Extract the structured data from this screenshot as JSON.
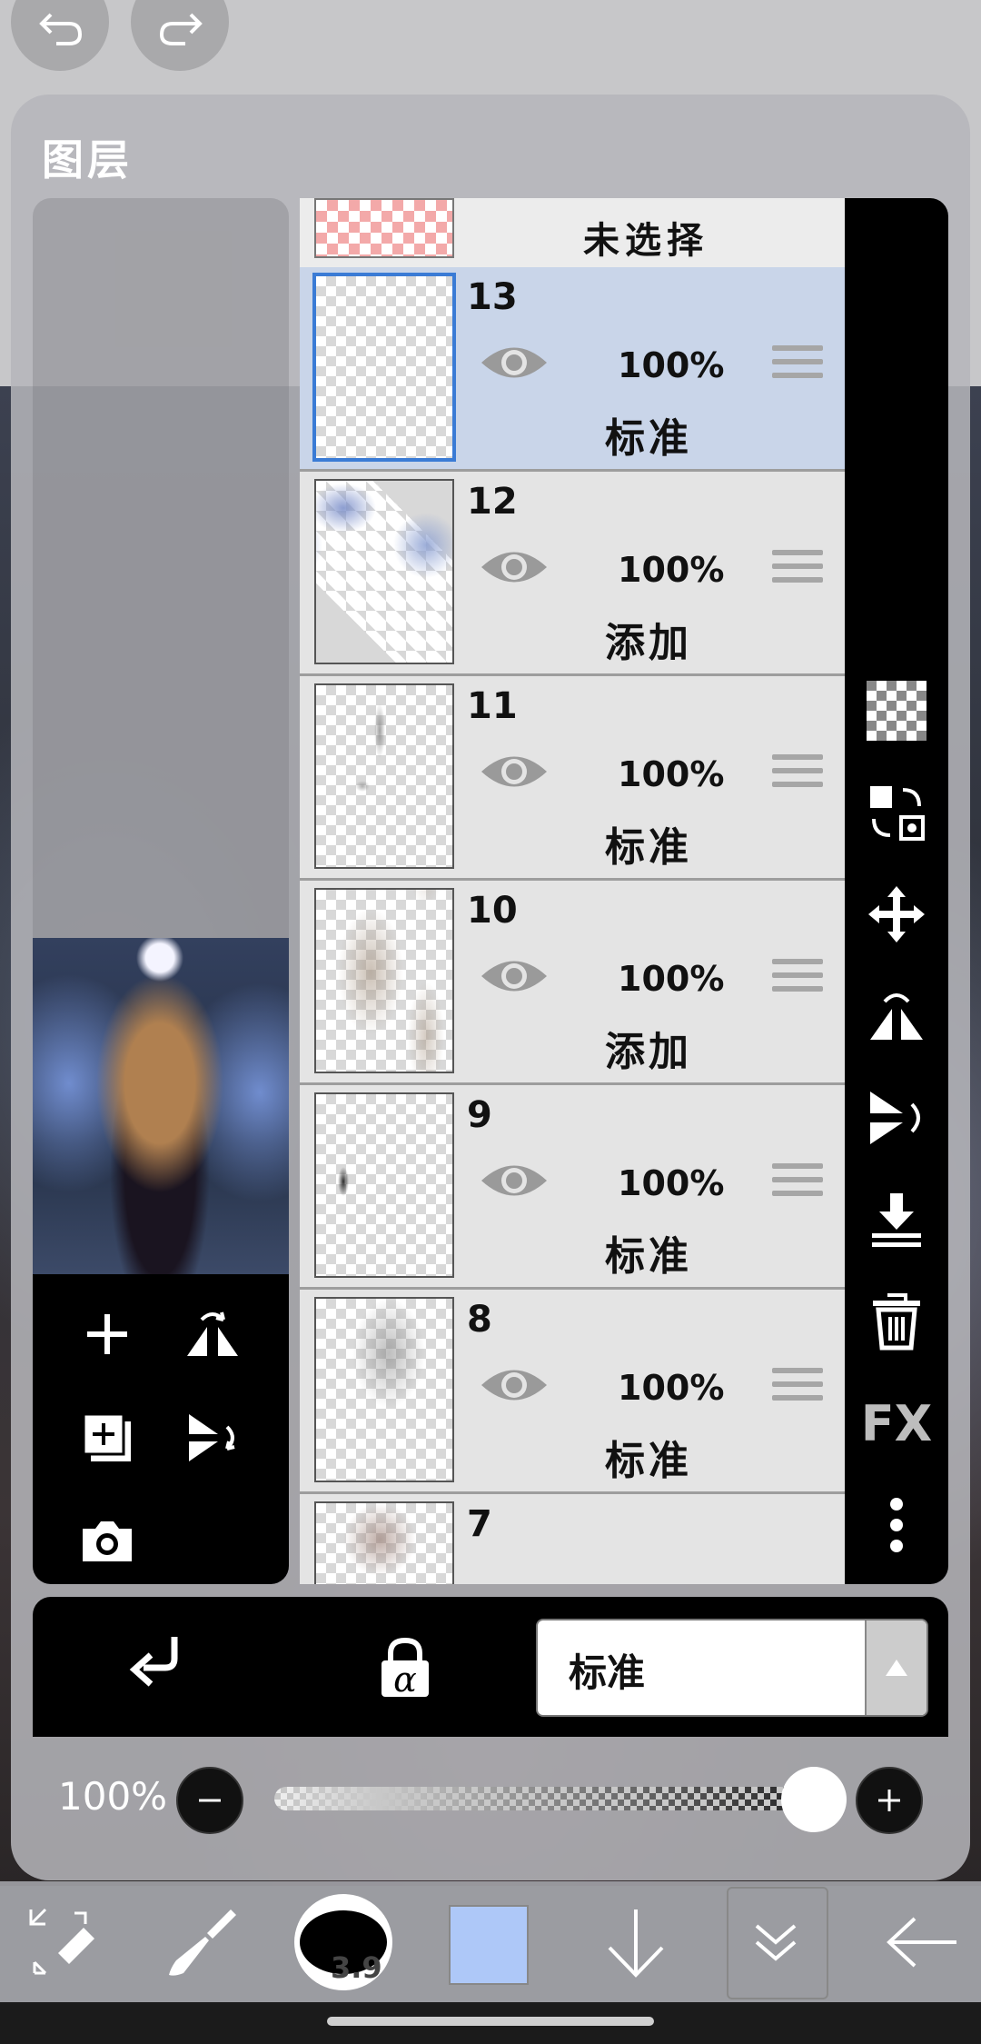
{
  "panel": {
    "title": "图层"
  },
  "unselect": {
    "label": "未选择"
  },
  "layers": [
    {
      "number": "13",
      "opacity": "100%",
      "blend": "标准",
      "selected": true
    },
    {
      "number": "12",
      "opacity": "100%",
      "blend": "添加",
      "selected": false
    },
    {
      "number": "11",
      "opacity": "100%",
      "blend": "标准",
      "selected": false
    },
    {
      "number": "10",
      "opacity": "100%",
      "blend": "添加",
      "selected": false
    },
    {
      "number": "9",
      "opacity": "100%",
      "blend": "标准",
      "selected": false
    },
    {
      "number": "8",
      "opacity": "100%",
      "blend": "标准",
      "selected": false
    },
    {
      "number": "7",
      "opacity": "",
      "blend": "",
      "selected": false
    }
  ],
  "right_tools": {
    "fx_label": "FX"
  },
  "bottom_bar": {
    "blend_mode": "标准",
    "alpha_label": "α"
  },
  "opacity_control": {
    "label": "100%",
    "value": 1.0
  },
  "toolbar": {
    "brush_size": "3.9",
    "color": "#aec8f8"
  },
  "colors": {
    "selected_row": "#c9d5e9",
    "selected_border": "#3a7bd5"
  }
}
